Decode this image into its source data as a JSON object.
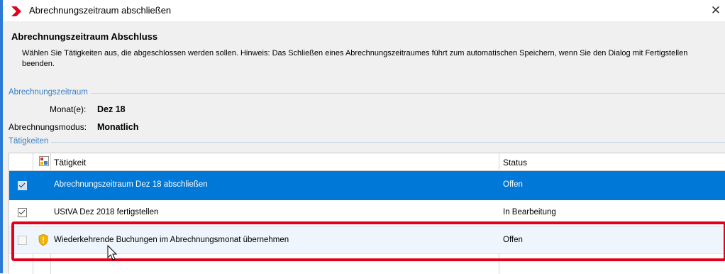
{
  "window": {
    "title": "Abrechnungszeitraum abschließen",
    "close_glyph": "✕"
  },
  "header": {
    "title": "Abrechnungszeitraum Abschluss",
    "description": "Wählen Sie Tätigkeiten aus, die abgeschlossen werden sollen. Hinweis: Das Schließen eines Abrechnungszeitraumes führt zum automatischen Speichern, wenn Sie den Dialog mit Fertigstellen beenden."
  },
  "period_group": {
    "label": "Abrechnungszeitraum",
    "month_label": "Monat(e):",
    "month_value": "Dez 18",
    "mode_label": "Abrechnungsmodus:",
    "mode_value": "Monatlich"
  },
  "activities_group": {
    "label": "Tätigkeiten"
  },
  "grid": {
    "col_activity": "Tätigkeit",
    "col_status": "Status",
    "rows": [
      {
        "checked": true,
        "activity": "Abrechnungszeitraum Dez 18 abschließen",
        "status": "Offen",
        "selected": true
      },
      {
        "checked": true,
        "activity": "UStVA Dez 2018 fertigstellen",
        "status": "In Bearbeitung",
        "selected": false
      },
      {
        "checked": false,
        "activity": "Wiederkehrende Buchungen im Abrechnungsmonat übernehmen",
        "status": "Offen",
        "selected": false,
        "warning_icon": "shield-warning-icon"
      }
    ]
  },
  "colors": {
    "accent": "#2b7bd6",
    "selection": "#0078d7",
    "group_label": "#3b7fc4",
    "highlight": "#e3001b",
    "warning": "#f5b400"
  }
}
